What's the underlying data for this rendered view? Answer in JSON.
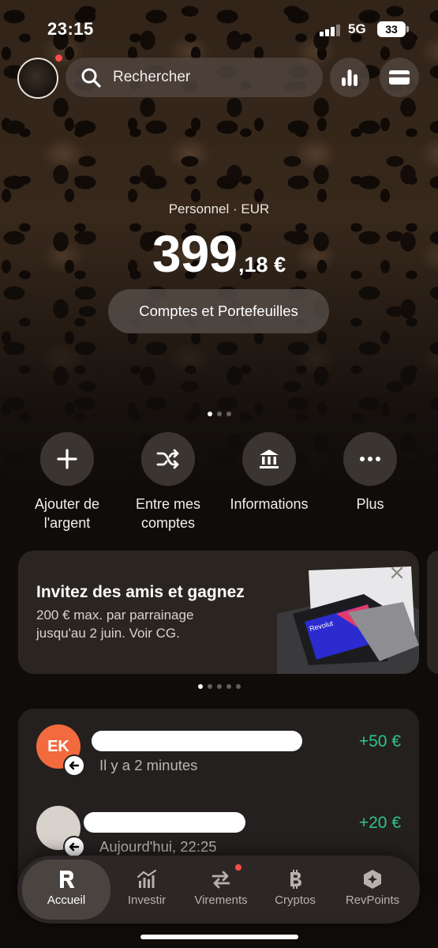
{
  "status": {
    "time": "23:15",
    "network": "5G",
    "battery": "33"
  },
  "search": {
    "placeholder": "Rechercher"
  },
  "account": {
    "label": "Personnel · EUR",
    "balance_int": "399",
    "balance_dec": ",18 €",
    "accounts_button": "Comptes et Portefeuilles"
  },
  "actions": [
    {
      "label1": "Ajouter de",
      "label2": "l'argent",
      "icon": "plus-icon"
    },
    {
      "label1": "Entre mes",
      "label2": "comptes",
      "icon": "shuffle-icon"
    },
    {
      "label1": "Informations",
      "label2": "",
      "icon": "bank-icon"
    },
    {
      "label1": "Plus",
      "label2": "",
      "icon": "more-icon"
    }
  ],
  "promo": {
    "title": "Invitez des amis et gagnez",
    "line1": "200 € max. par parrainage",
    "line2": "jusqu'au 2 juin. Voir CG.",
    "card_brand": "Revolut"
  },
  "transactions": [
    {
      "initials": "EK",
      "time": "Il y a 2 minutes",
      "amount": "+50 €",
      "avatar_color": "#f26a3d"
    },
    {
      "initials": "",
      "time": "Aujourd'hui, 22:25",
      "amount": "+20 €",
      "avatar_color": "#d8d2cc"
    }
  ],
  "tabs": [
    {
      "label": "Accueil",
      "icon": "revolut-r-icon",
      "active": true
    },
    {
      "label": "Investir",
      "icon": "chart-bars-icon",
      "active": false
    },
    {
      "label": "Virements",
      "icon": "transfer-arrows-icon",
      "active": false
    },
    {
      "label": "Cryptos",
      "icon": "bitcoin-icon",
      "active": false
    },
    {
      "label": "RevPoints",
      "icon": "revpoints-icon",
      "active": false
    }
  ],
  "colors": {
    "positive": "#2fc38d",
    "notification": "#ff4a4a"
  }
}
